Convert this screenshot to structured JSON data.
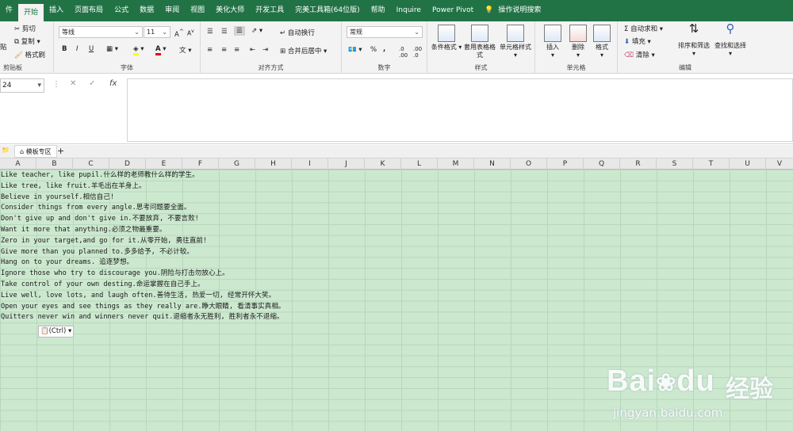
{
  "tabs": [
    "件",
    "开始",
    "插入",
    "页面布局",
    "公式",
    "数据",
    "审阅",
    "视图",
    "美化大师",
    "开发工具",
    "完美工具箱(64位版)",
    "帮助",
    "Inquire",
    "Power Pivot",
    "操作说明搜索"
  ],
  "clipboard": {
    "paste": "贴",
    "cut": "剪切",
    "copy": "复制",
    "painter": "格式刷",
    "label": "剪贴板"
  },
  "font": {
    "name": "等线",
    "size": "11",
    "grow": "A",
    "shrink": "A",
    "bold": "B",
    "italic": "I",
    "underline": "U",
    "wen": "文",
    "label": "字体"
  },
  "align": {
    "wrap": "自动换行",
    "merge": "合并后居中",
    "label": "对齐方式"
  },
  "number": {
    "format": "常规",
    "pct": "%",
    "comma": ",",
    "label": "数字"
  },
  "styles": {
    "cond": "条件格式",
    "table": "套用表格格式",
    "cell": "单元格样式",
    "label": "样式"
  },
  "cells": {
    "insert": "插入",
    "delete": "删除",
    "format": "格式",
    "label": "单元格"
  },
  "edit": {
    "autosum": "自动求和",
    "fill": "填充",
    "clear": "清除",
    "sort": "排序和筛选",
    "find": "查找和选择",
    "label": "编辑"
  },
  "formula_bar": {
    "name_box": "24",
    "fx": "fx"
  },
  "sheet_tab": "模板专区",
  "columns": [
    "A",
    "B",
    "C",
    "D",
    "E",
    "F",
    "G",
    "H",
    "I",
    "J",
    "K",
    "L",
    "M",
    "N",
    "O",
    "P",
    "Q",
    "R",
    "S",
    "T",
    "U",
    "V"
  ],
  "rows": [
    "Like teacher, like pupil.什么样的老师教什么样的学生。",
    "Like tree, like fruit.羊毛出在羊身上。",
    "Believe in yourself.相信自己!",
    "Consider things from every angle.思考问题要全面。",
    "Don't give up and don't give in.不要放弃, 不要言败!",
    "Want it more that anything.必须之物最重要。",
    "Zero in your target,and go for it.从零开始, 勇往直前!",
    "Give more than you planned to.多多给予, 不必计较。",
    "Hang on to your dreams. 追逐梦想。",
    "Ignore those who try to discourage you.阴险与打击勿放心上。",
    "Take control of your own desting.命运掌握在自己手上。",
    "Live well, love lots, and laugh often.善待生活, 热爱一切, 经常开怀大笑。",
    "Open your eyes and see things as they really are.睁大眼睛, 看清事实真相。",
    "Quitters never win and winners never quit.退缩者永无胜利, 胜利者永不退缩。"
  ],
  "paste_options": "(Ctrl)",
  "watermark": {
    "brand": "Bai",
    "brand2": "du",
    "cn": "经验",
    "url": "jingyan.baidu.com"
  },
  "colors": {
    "excel_green": "#217346",
    "grid_bg": "#cce8cf"
  }
}
